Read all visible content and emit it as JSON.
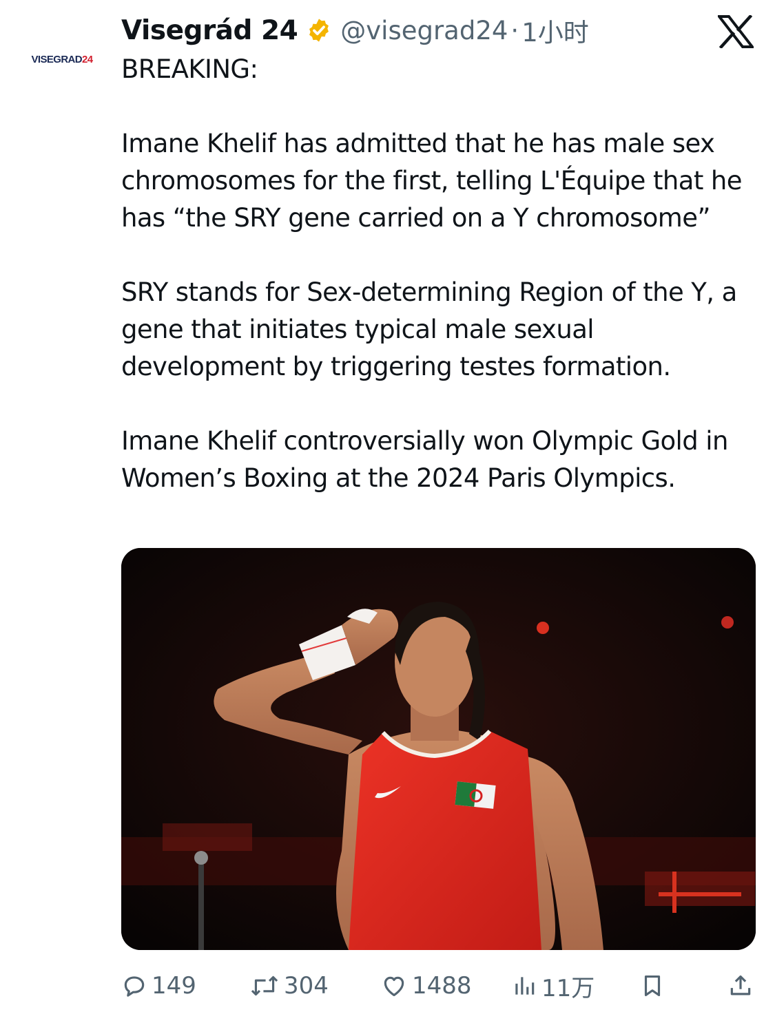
{
  "author": {
    "display_name": "Visegrád 24",
    "handle": "@visegrad24",
    "separator": "·",
    "timestamp": "1小时",
    "avatar_text_main": "VISEGRAD",
    "avatar_text_accent": "24",
    "verified_badge_color": "#f4b400"
  },
  "platform": {
    "logo": "x-logo"
  },
  "tweet": {
    "paragraphs": [
      "BREAKING:",
      "Imane Khelif has admitted that he has male sex chromosomes for the first, telling L'Équipe that he has “the SRY gene carried on a Y chromosome”",
      "SRY stands for Sex-determining Region of the Y, a gene that initiates typical male sexual development by triggering testes formation.",
      "Imane Khelif controversially won Olympic Gold in Women’s Boxing at the 2024 Paris Olympics."
    ]
  },
  "media": {
    "kind": "photo",
    "subject_colors": {
      "background": "#0b0606",
      "jersey": "#e0251d",
      "arena_light": "#c8201a"
    }
  },
  "actions": {
    "reply_count": "149",
    "retweet_count": "304",
    "like_count": "1488",
    "view_count": "11万",
    "icons": [
      "reply-icon",
      "retweet-icon",
      "heart-icon",
      "views-icon",
      "bookmark-icon",
      "share-icon"
    ]
  }
}
